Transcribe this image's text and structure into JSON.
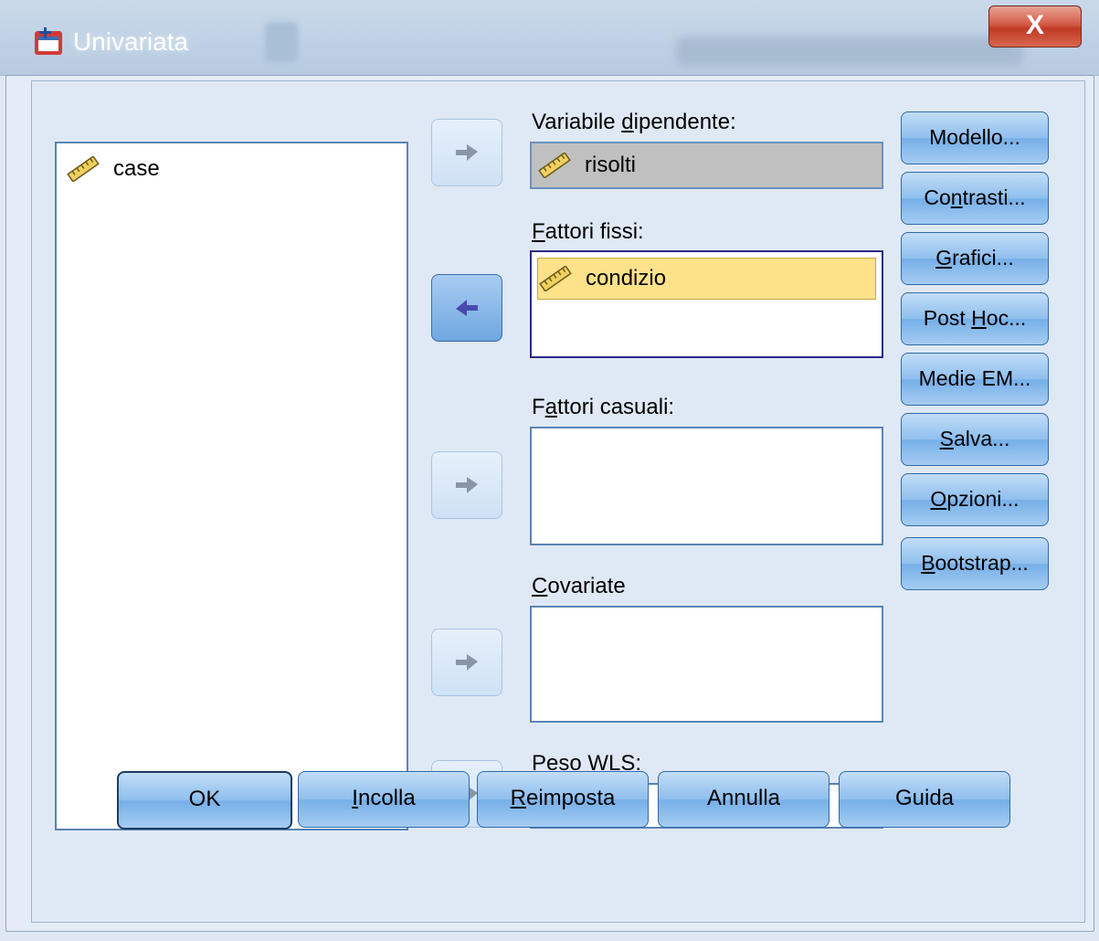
{
  "window": {
    "title": "Univariata",
    "close_glyph": "X",
    "icon": "spss-dialog-icon"
  },
  "source_list": {
    "items": [
      {
        "label": "case",
        "icon": "scale-ruler-icon"
      }
    ]
  },
  "targets": {
    "dependent": {
      "label_pre": "Variabile ",
      "label_u": "d",
      "label_post": "ipendente:",
      "value": "risolti"
    },
    "fixed": {
      "label_pre": "",
      "label_u": "F",
      "label_post": "attori fissi:",
      "items": [
        "condizio"
      ]
    },
    "random": {
      "label_pre": "F",
      "label_u": "a",
      "label_post": "ttori casuali:"
    },
    "covariate": {
      "label_pre": "",
      "label_u": "C",
      "label_post": "ovariate"
    },
    "wls": {
      "label_pre": "Peso ",
      "label_u": "W",
      "label_post": "LS:"
    }
  },
  "side_buttons": {
    "model": {
      "pre": "Modello...",
      "u": "",
      "post": ""
    },
    "contrasts": {
      "pre": "Co",
      "u": "n",
      "post": "trasti..."
    },
    "plots": {
      "pre": "",
      "u": "G",
      "post": "rafici..."
    },
    "posthoc": {
      "pre": "Post ",
      "u": "H",
      "post": "oc..."
    },
    "emmeans": {
      "pre": "Medie EM...",
      "u": "",
      "post": ""
    },
    "save": {
      "pre": "",
      "u": "S",
      "post": "alva..."
    },
    "options": {
      "pre": "",
      "u": "O",
      "post": "pzioni..."
    },
    "bootstrap": {
      "pre": "",
      "u": "B",
      "post": "ootstrap..."
    }
  },
  "bottom_buttons": {
    "ok": {
      "pre": "OK",
      "u": "",
      "post": ""
    },
    "paste": {
      "pre": "",
      "u": "I",
      "post": "ncolla"
    },
    "reset": {
      "pre": "",
      "u": "R",
      "post": "eimposta"
    },
    "cancel": {
      "pre": "Annulla",
      "u": "",
      "post": ""
    },
    "help": {
      "pre": "Guida",
      "u": "",
      "post": ""
    }
  },
  "colors": {
    "accent": "#5a84b5",
    "chip": "#fde28a",
    "close": "#c13a25"
  }
}
